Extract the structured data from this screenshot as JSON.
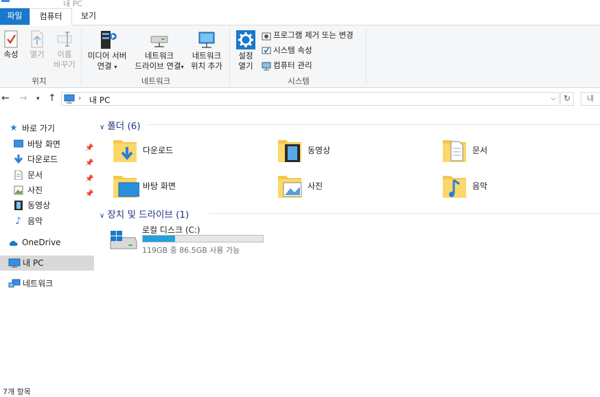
{
  "window": {
    "title": "내 PC"
  },
  "tabs": [
    {
      "label": "파일"
    },
    {
      "label": "컴퓨터"
    },
    {
      "label": "보기"
    }
  ],
  "ribbon": {
    "location_group": {
      "label": "위치",
      "properties": "속성",
      "open": "열기",
      "rename_line1": "이름",
      "rename_line2": "바꾸기"
    },
    "network_group": {
      "label": "네트워크",
      "media_line1": "미디어 서버",
      "media_line2": "연결",
      "map_line1": "네트워크",
      "map_line2": "드라이브 연결",
      "add_line1": "네트워크",
      "add_line2": "위치 추가"
    },
    "system_group": {
      "label": "시스템",
      "settings_line1": "설정",
      "settings_line2": "열기",
      "uninstall": "프로그램 제거 또는 변경",
      "system_properties": "시스템 속성",
      "manage": "컴퓨터 관리"
    }
  },
  "address": {
    "path": "내 PC",
    "search_placeholder": "내"
  },
  "nav": {
    "quick_access": "바로 가기",
    "items": [
      {
        "label": "바탕 화면"
      },
      {
        "label": "다운로드"
      },
      {
        "label": "문서"
      },
      {
        "label": "사진"
      },
      {
        "label": "동영상"
      },
      {
        "label": "음악"
      }
    ],
    "onedrive": "OneDrive",
    "this_pc": "내 PC",
    "network": "네트워크"
  },
  "folders_section": {
    "header": "폴더 (6)",
    "items": [
      {
        "label": "다운로드"
      },
      {
        "label": "동영상"
      },
      {
        "label": "문서"
      },
      {
        "label": "바탕 화면"
      },
      {
        "label": "사진"
      },
      {
        "label": "음악"
      }
    ]
  },
  "drives_section": {
    "header": "장치 및 드라이브 (1)",
    "drive": {
      "name": "로컬 디스크 (C:)",
      "space": "119GB 중 86.5GB 사용 가능",
      "used_fraction": 0.27
    }
  },
  "status": {
    "count": "7개 항목"
  },
  "colors": {
    "accent": "#1979ca",
    "drive_bar": "#26a0da",
    "header_text": "#1e3287"
  }
}
